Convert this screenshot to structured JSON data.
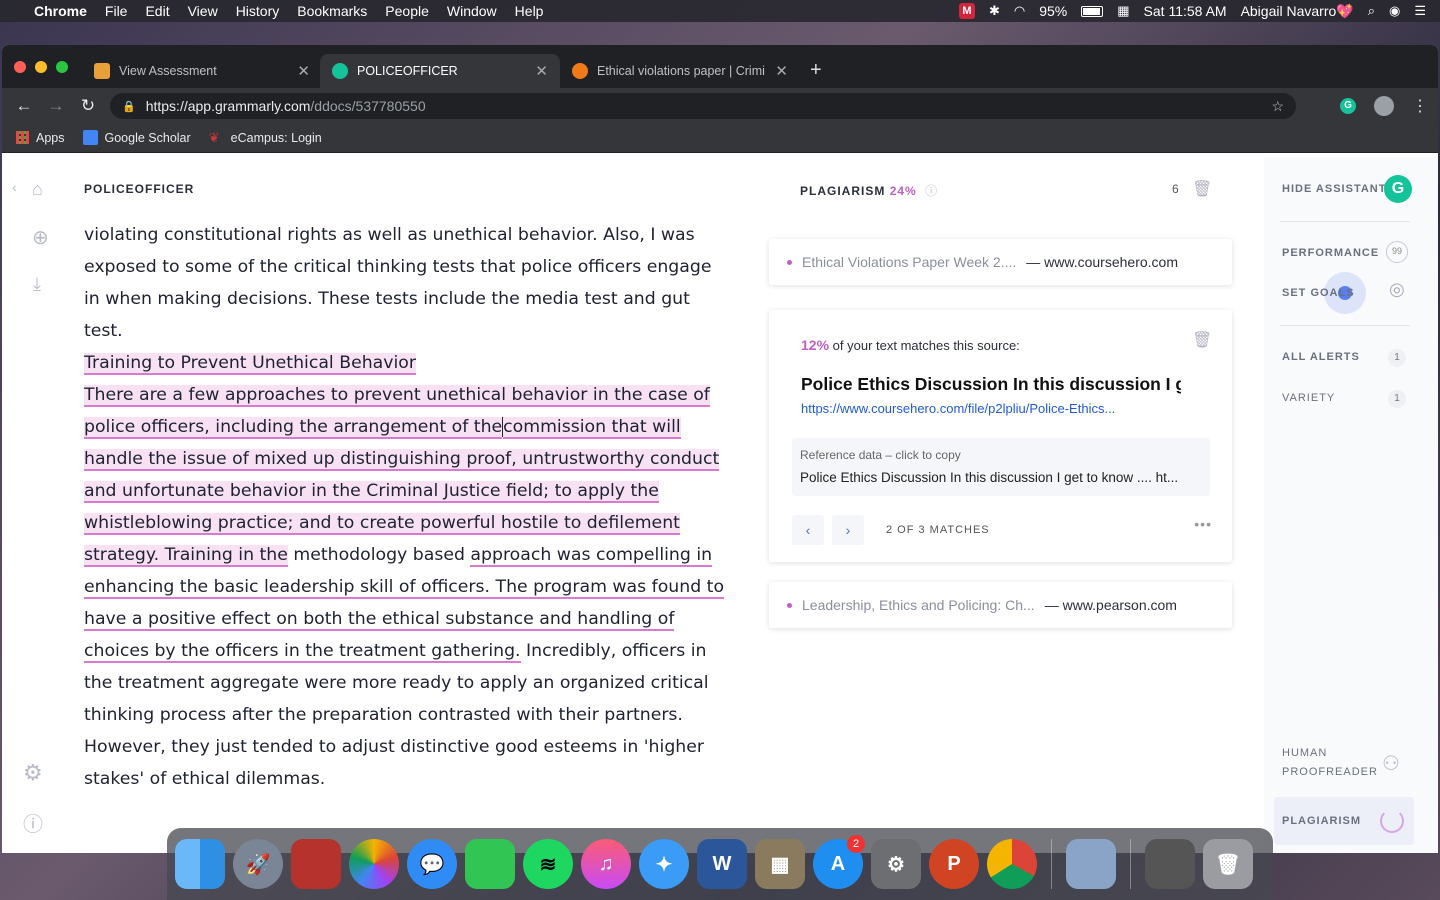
{
  "menubar": {
    "app": "Chrome",
    "menus": [
      "File",
      "Edit",
      "View",
      "History",
      "Bookmarks",
      "People",
      "Window",
      "Help"
    ],
    "battery": "95%",
    "clock": "Sat 11:58 AM",
    "user": "Abigail Navarro💖"
  },
  "tabs": [
    {
      "title": "View Assessment",
      "color": "#e8a13a"
    },
    {
      "title": "POLICEOFFICER",
      "color": "#15c39a"
    },
    {
      "title": "Ethical violations paper | Crimi",
      "color": "#f07a1a"
    }
  ],
  "url": {
    "host": "https://app.grammarly.com",
    "path": "/ddocs/537780550"
  },
  "bookmarks": [
    "Apps",
    "Google Scholar",
    "eCampus: Login"
  ],
  "doc": {
    "title": "POLICEOFFICER",
    "p1": "violating constitutional rights as well as unethical behavior. Also, I was exposed to some of the critical thinking tests that police officers engage in when making decisions. These tests include the media test and gut test.",
    "heading": "Training to Prevent Unethical Behavior",
    "p2_hl1": "There are a few approaches to prevent unethical behavior in the case of police officers, including the arrangement of the",
    "p2_hl2": "commission that will handle the issue of mixed up distinguishing proof, untrustworthy conduct and unfortunate behavior in the Criminal Justice field; to apply the whistleblowing practice; and to create powerful hostile to defilement strategy. Training in the",
    "p2_plain1": " methodology based ",
    "p2_ul": "approach was compelling in enhancing the basic leadership skill of officers. The program was found to have a positive effect on both the ethical substance and handling of choices by the officers in the treatment gathering.",
    "p2_rest": " Incredibly, officers in the treatment aggregate were more ready to apply an organized critical thinking process after the preparation contrasted with their partners. However, they just tended to adjust distinctive good esteems in 'higher stakes' of ethical dilemmas."
  },
  "plagiarism": {
    "label": "PLAGIARISM",
    "percent": "24%",
    "count": "6",
    "source1": {
      "title": "Ethical Violations Paper Week 2....",
      "site": "— www.coursehero.com"
    },
    "active": {
      "match_pct": "12%",
      "match_text": "of your text matches this source:",
      "title": "Police Ethics Discussion In this discussion I g",
      "link": "https://www.coursehero.com/file/p2lpliu/Police-Ethics...",
      "ref_label": "Reference data – click to copy",
      "ref_text": "Police Ethics Discussion In this discussion I get to know .... ht...",
      "pager": "2 OF 3 MATCHES"
    },
    "source3": {
      "title": "Leadership, Ethics and Policing: Ch...",
      "site": "— www.pearson.com"
    }
  },
  "assistant": {
    "hide": "HIDE ASSISTANT",
    "performance": "PERFORMANCE",
    "score": "99",
    "set_goals": "SET GOALS",
    "all_alerts": "ALL ALERTS",
    "all_alerts_count": "1",
    "variety": "VARIETY",
    "variety_count": "1",
    "human_1": "HUMAN",
    "human_2": "PROOFREADER",
    "plagiarism": "PLAGIARISM"
  },
  "dock": {
    "appstore_badge": "2"
  }
}
